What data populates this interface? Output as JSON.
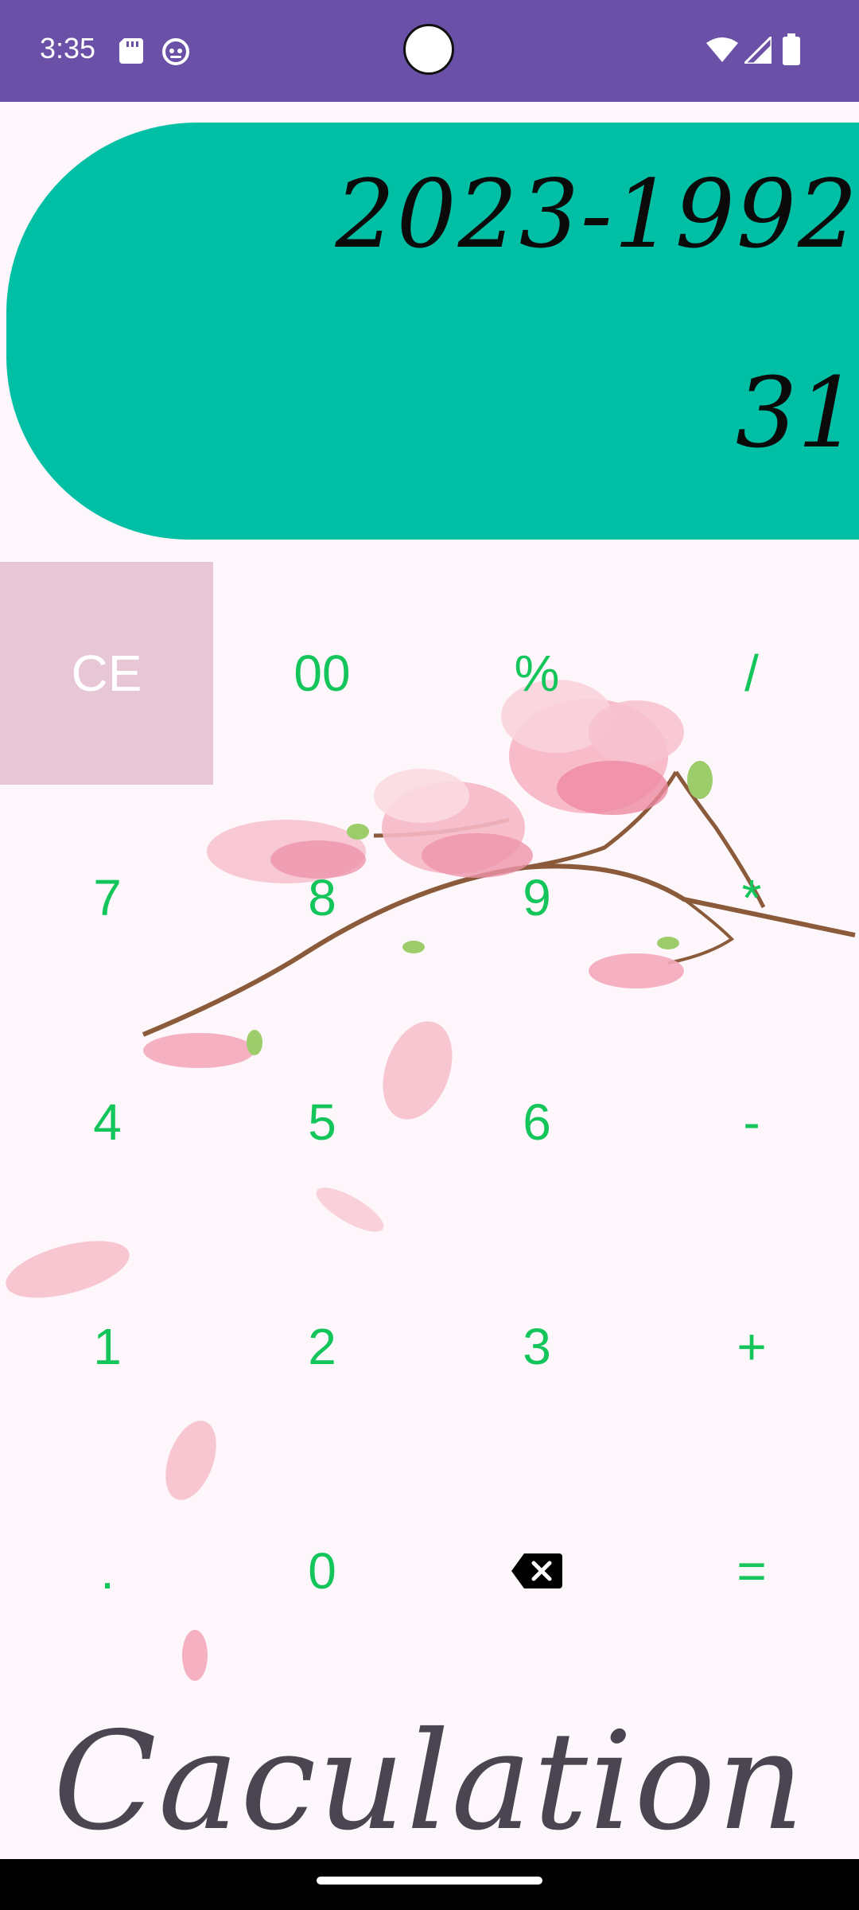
{
  "status_bar": {
    "time": "3:35",
    "icons": [
      "sd-card-icon",
      "notification-icon",
      "wifi-icon",
      "signal-icon",
      "battery-icon"
    ],
    "background": "#6a50a6"
  },
  "display": {
    "expression": "2023-1992",
    "result": "31",
    "background": "#00bfa5"
  },
  "keys": {
    "ce": "CE",
    "double_zero": "00",
    "percent": "%",
    "divide": "/",
    "seven": "7",
    "eight": "8",
    "nine": "9",
    "multiply": "*",
    "four": "4",
    "five": "5",
    "six": "6",
    "minus": "-",
    "one": "1",
    "two": "2",
    "three": "3",
    "plus": "+",
    "dot": ".",
    "zero": "0",
    "backspace_icon": "backspace-icon",
    "equals": "=",
    "key_color": "#13c55a",
    "ce_color": "#e7c6d6"
  },
  "footer": {
    "title": "Caculation"
  }
}
